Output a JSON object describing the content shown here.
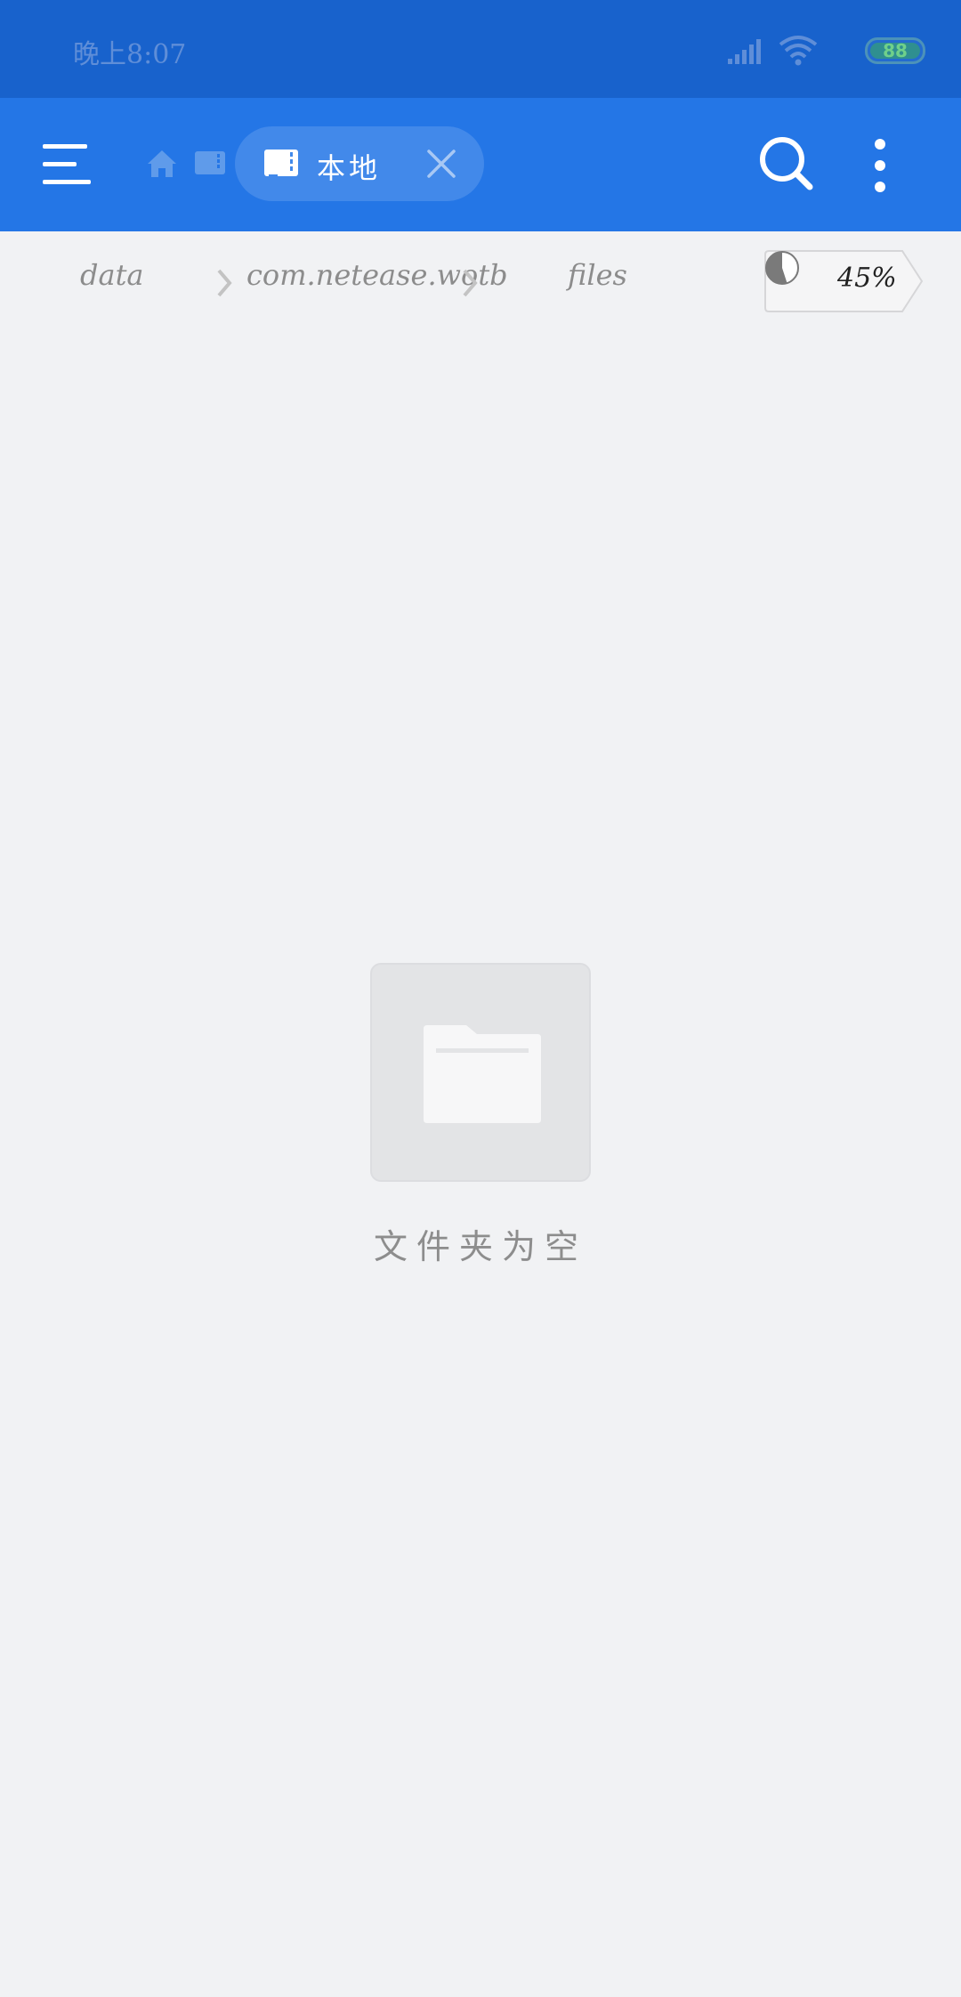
{
  "status_bar": {
    "time": "晚上8:07",
    "battery": "88",
    "icons": [
      "signal-icon",
      "wifi-icon",
      "battery-icon"
    ]
  },
  "app_bar": {
    "tab": {
      "label": "本地",
      "icon": "sd-card-icon"
    },
    "icons": [
      "menu-icon",
      "home-icon",
      "sd-card-icon",
      "close-icon",
      "search-icon",
      "more-vert-icon"
    ]
  },
  "breadcrumb": {
    "items": [
      "data",
      "com.netease.wotb",
      "files"
    ],
    "storage_percent": "45%",
    "storage_fraction": 0.45
  },
  "empty_state": {
    "message": "文件夹为空",
    "icon": "folder-icon"
  },
  "colors": {
    "status_bar": "#1862cc",
    "app_bar": "#2476e6",
    "tab_pill": "#4289ea",
    "background": "#f1f2f4"
  }
}
